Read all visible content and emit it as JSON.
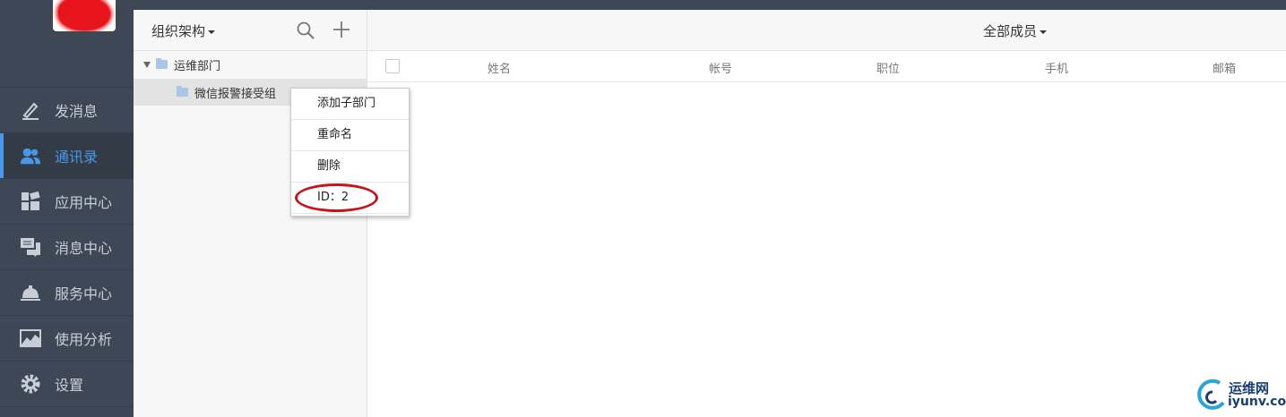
{
  "sidebar": {
    "items": [
      {
        "label": "发消息",
        "icon": "pencil-icon"
      },
      {
        "label": "通讯录",
        "icon": "contacts-icon",
        "active": true
      },
      {
        "label": "应用中心",
        "icon": "apps-icon"
      },
      {
        "label": "消息中心",
        "icon": "messages-icon"
      },
      {
        "label": "服务中心",
        "icon": "service-bell-icon"
      },
      {
        "label": "使用分析",
        "icon": "analytics-chart-icon"
      },
      {
        "label": "设置",
        "icon": "gear-icon"
      }
    ],
    "accent_color": "#4a97e8"
  },
  "org": {
    "title": "组织架构",
    "root": "运维部门",
    "child": "微信报警接受组"
  },
  "context_menu": {
    "items": [
      "添加子部门",
      "重命名",
      "删除",
      "ID：2"
    ]
  },
  "members": {
    "filter": "全部成员",
    "columns": [
      "姓名",
      "帐号",
      "职位",
      "手机",
      "邮箱"
    ]
  },
  "watermark": {
    "line1": "运维网",
    "line2": "iyunv.com"
  }
}
